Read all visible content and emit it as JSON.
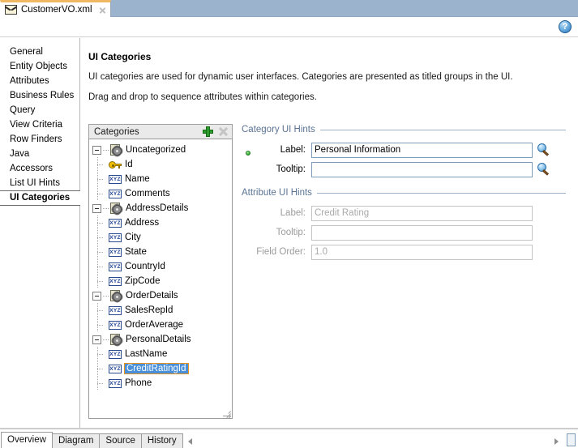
{
  "window": {
    "tab": {
      "icon": "xml-file-icon",
      "title": "CustomerVO.xml",
      "close": "×"
    },
    "help_icon_glyph": "?"
  },
  "sidebar": {
    "items": [
      {
        "label": "General",
        "selected": false
      },
      {
        "label": "Entity Objects",
        "selected": false
      },
      {
        "label": "Attributes",
        "selected": false
      },
      {
        "label": "Business Rules",
        "selected": false
      },
      {
        "label": "Query",
        "selected": false
      },
      {
        "label": "View Criteria",
        "selected": false
      },
      {
        "label": "Row Finders",
        "selected": false
      },
      {
        "label": "Java",
        "selected": false
      },
      {
        "label": "Accessors",
        "selected": false
      },
      {
        "label": "List UI Hints",
        "selected": false
      },
      {
        "label": "UI Categories",
        "selected": true
      }
    ]
  },
  "main": {
    "title": "UI Categories",
    "description_1": "UI categories are used for dynamic user interfaces. Categories are presented as titled groups in the UI.",
    "description_2": "Drag and drop to sequence attributes within categories."
  },
  "categories_panel": {
    "header_title": "Categories",
    "add_icon": "plus-icon",
    "delete_icon": "close-icon",
    "tree": [
      {
        "label": "Uncategorized",
        "type": "category",
        "expanded": true,
        "children": [
          {
            "label": "Id",
            "type": "key",
            "selected": false
          },
          {
            "label": "Name",
            "type": "attribute",
            "selected": false
          },
          {
            "label": "Comments",
            "type": "attribute",
            "selected": false
          }
        ]
      },
      {
        "label": "AddressDetails",
        "type": "category",
        "expanded": true,
        "children": [
          {
            "label": "Address",
            "type": "attribute",
            "selected": false
          },
          {
            "label": "City",
            "type": "attribute",
            "selected": false
          },
          {
            "label": "State",
            "type": "attribute",
            "selected": false
          },
          {
            "label": "CountryId",
            "type": "attribute",
            "selected": false
          },
          {
            "label": "ZipCode",
            "type": "attribute",
            "selected": false
          }
        ]
      },
      {
        "label": "OrderDetails",
        "type": "category",
        "expanded": true,
        "children": [
          {
            "label": "SalesRepId",
            "type": "attribute",
            "selected": false
          },
          {
            "label": "OrderAverage",
            "type": "attribute",
            "selected": false
          }
        ]
      },
      {
        "label": "PersonalDetails",
        "type": "category",
        "expanded": true,
        "children": [
          {
            "label": "LastName",
            "type": "attribute",
            "selected": false
          },
          {
            "label": "CreditRatingId",
            "type": "attribute",
            "selected": true
          },
          {
            "label": "Phone",
            "type": "attribute",
            "selected": false
          }
        ]
      }
    ],
    "xyz_icon_text": "XYZ"
  },
  "category_hints": {
    "legend": "Category UI Hints",
    "label_label": "Label:",
    "label_value": "Personal Information",
    "label_placeholder": "",
    "tooltip_label": "Tooltip:",
    "tooltip_value": "",
    "tooltip_placeholder": "",
    "search_icon": "magnifier-icon"
  },
  "attribute_hints": {
    "legend": "Attribute UI Hints",
    "label_label": "Label:",
    "label_value": "Credit Rating",
    "tooltip_label": "Tooltip:",
    "tooltip_value": "",
    "field_order_label": "Field Order:",
    "field_order_value": "1.0"
  },
  "bottom_tabs": {
    "items": [
      {
        "label": "Overview",
        "active": true
      },
      {
        "label": "Diagram",
        "active": false
      },
      {
        "label": "Source",
        "active": false
      },
      {
        "label": "History",
        "active": false
      }
    ]
  },
  "colors": {
    "tabstrip_bg": "#9cb3ce",
    "tab_accent": "#f0b862",
    "selection_blue": "#4a90d9",
    "selection_outline": "#e8921f",
    "legend_text": "#5a7393",
    "add_green": "#2d9b2d"
  }
}
